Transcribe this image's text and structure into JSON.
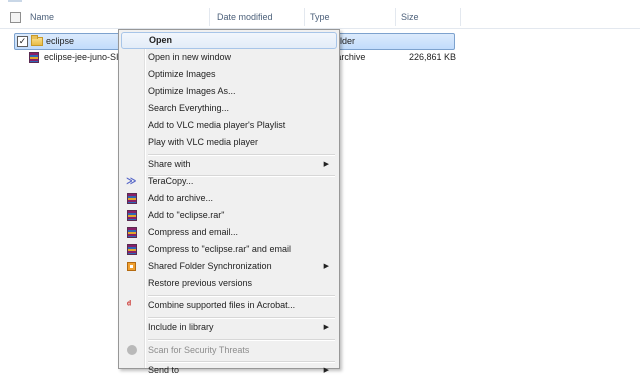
{
  "explorer": {
    "columns": {
      "name": "Name",
      "date_modified": "Date modified",
      "type": "Type",
      "size": "Size"
    },
    "rows": [
      {
        "name": "eclipse",
        "type_partial": "lder",
        "checked": true
      },
      {
        "name": "eclipse-jee-juno-SI",
        "type": "ZIP archive",
        "size": "226,861 KB"
      }
    ]
  },
  "context_menu": {
    "items": {
      "open": "Open",
      "open_new_window": "Open in new window",
      "optimize_images": "Optimize Images",
      "optimize_images_as": "Optimize Images As...",
      "search_everything": "Search Everything...",
      "add_vlc_playlist": "Add to VLC media player's Playlist",
      "play_vlc": "Play with VLC media player",
      "share_with": "Share with",
      "teracopy": "TeraCopy...",
      "add_to_archive": "Add to archive...",
      "add_to_rar": "Add to \"eclipse.rar\"",
      "compress_email": "Compress and email...",
      "compress_rar_email": "Compress to \"eclipse.rar\" and email",
      "shared_folder_sync": "Shared Folder Synchronization",
      "restore_versions": "Restore previous versions",
      "combine_acrobat": "Combine supported files in Acrobat...",
      "include_library": "Include in library",
      "scan_threats": "Scan for Security Threats",
      "send_to": "Send to"
    },
    "icons": {
      "teracopy": "teracopy-icon",
      "winrar": "winrar-icon",
      "sync": "sync-icon",
      "acrobat": "acrobat-icon",
      "scan": "scan-icon"
    },
    "submenu_arrow": "▶",
    "teracopy_glyph": "≫",
    "acrobat_glyph": "ᵈ"
  }
}
